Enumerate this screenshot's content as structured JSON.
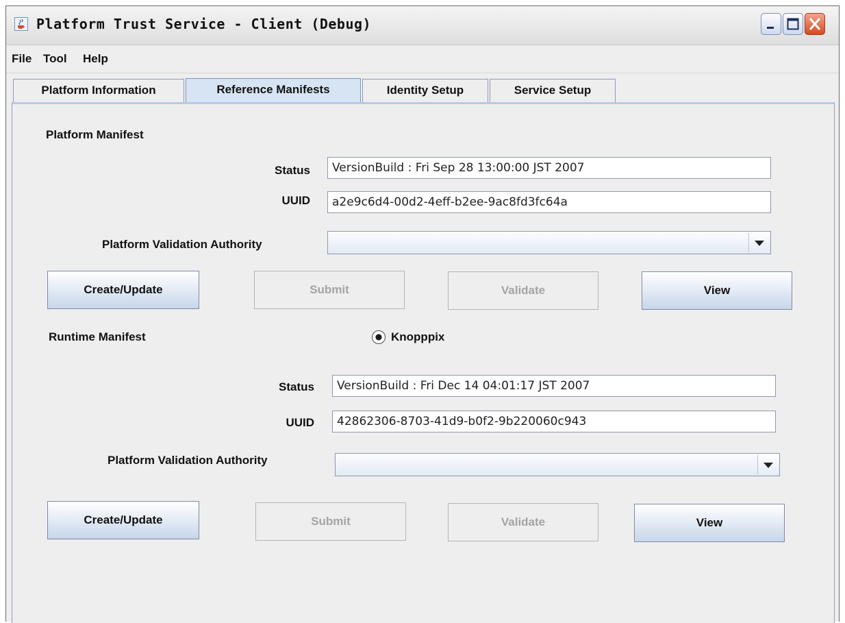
{
  "window": {
    "title": "Platform Trust Service - Client (Debug)",
    "icon": "java-cup-icon"
  },
  "menu": [
    "File",
    "Tool",
    "Help"
  ],
  "tabs": [
    {
      "label": "Platform Information",
      "selected": false
    },
    {
      "label": "Reference Manifests",
      "selected": true
    },
    {
      "label": "Identity Setup",
      "selected": false
    },
    {
      "label": "Service Setup",
      "selected": false
    }
  ],
  "platform_manifest": {
    "heading": "Platform Manifest",
    "status_label": "Status",
    "status_value": "VersionBuild : Fri Sep 28 13:00:00 JST 2007",
    "uuid_label": "UUID",
    "uuid_value": "a2e9c6d4-00d2-4eff-b2ee-9ac8fd3fc64a",
    "pva_label": "Platform Validation Authority",
    "pva_value": "",
    "buttons": {
      "create": "Create/Update",
      "submit": "Submit",
      "validate": "Validate",
      "view": "View"
    }
  },
  "runtime_manifest": {
    "heading": "Runtime Manifest",
    "radio_label": "Knopppix",
    "radio_selected": true,
    "status_label": "Status",
    "status_value": "VersionBuild : Fri Dec 14 04:01:17 JST 2007",
    "uuid_label": "UUID",
    "uuid_value": "42862306-8703-41d9-b0f2-9b220060c943",
    "pva_label": "Platform Validation Authority",
    "pva_value": "",
    "buttons": {
      "create": "Create/Update",
      "submit": "Submit",
      "validate": "Validate",
      "view": "View"
    }
  }
}
